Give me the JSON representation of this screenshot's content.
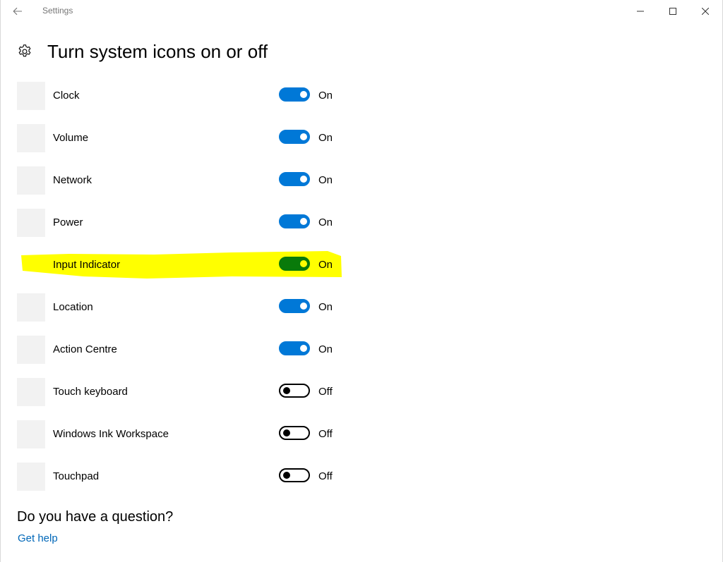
{
  "window": {
    "app_title": "Settings",
    "controls": [
      "minimize",
      "maximize",
      "close"
    ]
  },
  "page": {
    "title": "Turn system icons on or off"
  },
  "rows": [
    {
      "label": "Clock",
      "state": "On",
      "on": true
    },
    {
      "label": "Volume",
      "state": "On",
      "on": true
    },
    {
      "label": "Network",
      "state": "On",
      "on": true
    },
    {
      "label": "Power",
      "state": "On",
      "on": true
    },
    {
      "label": "Input Indicator",
      "state": "On",
      "on": true,
      "highlighted": true
    },
    {
      "label": "Location",
      "state": "On",
      "on": true
    },
    {
      "label": "Action Centre",
      "state": "On",
      "on": true
    },
    {
      "label": "Touch keyboard",
      "state": "Off",
      "on": false
    },
    {
      "label": "Windows Ink Workspace",
      "state": "Off",
      "on": false
    },
    {
      "label": "Touchpad",
      "state": "Off",
      "on": false
    }
  ],
  "help": {
    "question": "Do you have a question?",
    "link": "Get help"
  },
  "colors": {
    "accent": "#0078d7",
    "link": "#0067b8",
    "highlight": "#ffff00",
    "highlight_toggle": "#097a0a"
  }
}
